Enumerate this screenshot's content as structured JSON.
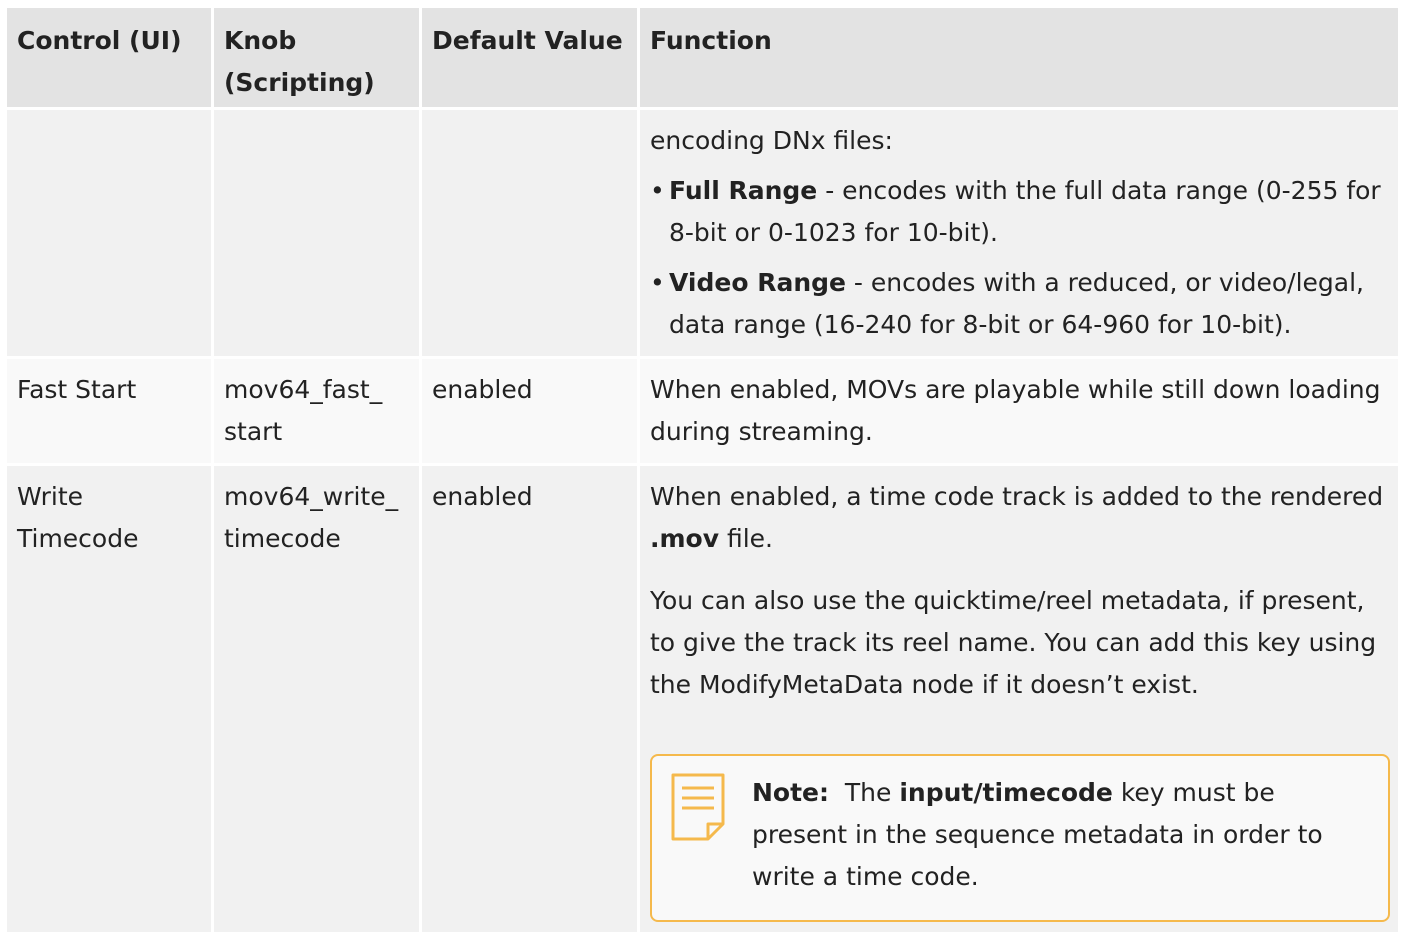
{
  "table": {
    "headers": [
      "Control (UI)",
      "Knob (Scripting)",
      "Default Value",
      "Function"
    ],
    "continued_row": {
      "intro": "encoding DNx files:",
      "bullets": [
        {
          "term": "Full Range",
          "text": " - encodes with the full data range (0-255 for 8-bit or 0-1023 for 10-bit)."
        },
        {
          "term": "Video Range",
          "text": " - encodes with a reduced, or video/legal, data range (16-240 for 8-bit or 64-960 for 10-bit)."
        }
      ]
    },
    "fast_start": {
      "control": "Fast Start",
      "knob": "mov64_fast_ start",
      "default": "enabled",
      "function": "When enabled, MOVs are playable while still down loading during streaming."
    },
    "write_timecode": {
      "control": "Write Timecode",
      "knob": "mov64_write_ timecode",
      "default": "enabled",
      "function_pre": "When enabled, a time code track is added to the rendered ",
      "function_bold": ".mov",
      "function_post": " file.",
      "para2": "You can also use the quicktime/reel metadata, if present, to give the track its reel name. You can add this key using the ModifyMetaData node if it doesn’t exist.",
      "note": {
        "label": "Note:",
        "pre": "  The ",
        "bold": "input/timecode",
        "post": " key must be present in the sequence metadata in order to write a time code."
      }
    }
  },
  "colors": {
    "header_bg": "#e3e3e3",
    "row_bg": "#f1f1f1",
    "row_alt_bg": "#f9f9f9",
    "note_border": "#f5b94c",
    "note_icon": "#f5b94c"
  },
  "icons": {
    "note": "note-icon"
  }
}
